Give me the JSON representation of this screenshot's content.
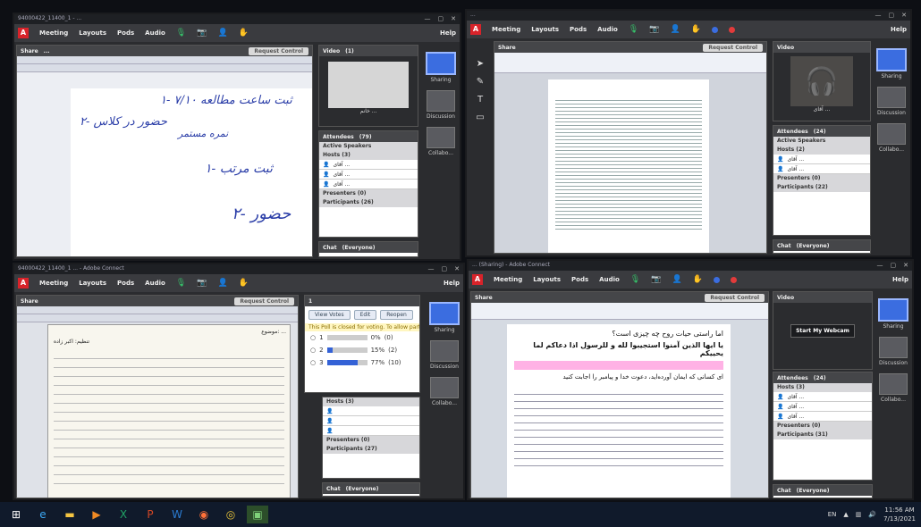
{
  "menu": {
    "meeting": "Meeting",
    "layouts": "Layouts",
    "pods": "Pods",
    "audio": "Audio",
    "help": "Help",
    "adobe": "Adobe"
  },
  "pods": {
    "share": "Share",
    "request_control": "Request Control",
    "video": "Video",
    "attendees": "Attendees",
    "active_speakers": "Active Speakers",
    "presenters": "Presenters (0)",
    "chat": "Chat",
    "chat_scope": "(Everyone)",
    "start_webcam": "Start My Webcam"
  },
  "side": {
    "sharing": "Sharing",
    "discussion": "Discussion",
    "collabo": "Collabo..."
  },
  "w1": {
    "title": "94000422_11400_1 - ...",
    "video_count": "(1)",
    "attendee_count": "(79)",
    "hosts": "Hosts (3)",
    "participants": "Participants (26)",
    "host_names": [
      "آقای ...",
      "آقای ...",
      "آقای ..."
    ],
    "video_name": "خانم ...",
    "share_title": "...",
    "hand1": "۱- ثبت ساعت مطالعه ۷/۱۰",
    "hand2": "۲- حضور در کلاس",
    "hand3": "نمره مستمر",
    "hand4": "۱- ثبت مرتب",
    "hand5": "۲- حضور"
  },
  "w2": {
    "title": "...",
    "attendee_count": "(24)",
    "hosts": "Hosts (2)",
    "participants": "Participants (22)",
    "presenters": "Presenters (0)",
    "host_names": [
      "آقای ...",
      "آقای ..."
    ],
    "video_name": "آقای ..."
  },
  "w3": {
    "title": "94000422_11400_1 ... - Adobe Connect",
    "view_votes": "View Votes",
    "edit": "Edit",
    "reopen": "Reopen",
    "poll_note": "This Poll is closed for voting. To allow part",
    "poll_rows": [
      {
        "n": "1",
        "pct": "0%",
        "count": "(0)",
        "fill": 0.0
      },
      {
        "n": "2",
        "pct": "15%",
        "count": "(2)",
        "fill": 0.15
      },
      {
        "n": "3",
        "pct": "77%",
        "count": "(10)",
        "fill": 0.77
      }
    ],
    "hosts": "Hosts (3)",
    "participants": "Participants (27)",
    "presenters": "Presenters (0)",
    "doc_title": "موضوع: ...",
    "doc_sub": "تنظیم: اکبر زاده"
  },
  "w4": {
    "title": "... (Sharing) - Adobe Connect",
    "attendee_count": "(24)",
    "hosts": "Hosts (3)",
    "participants": "Participants (31)",
    "presenters": "Presenters (0)",
    "host_names": [
      "آقای ...",
      "آقای ...",
      "آقای ..."
    ],
    "text1": "اما راستی حیات روح چه چیزی است؟",
    "text2": "یا ایها الذین آمنوا استجیبوا لله و للرسول اذا دعاکم لما یحییکم",
    "text3": "ای کسانی که ایمان آورده‌اید، دعوت خدا و پیامبر را اجابت کنید"
  },
  "taskbar": {
    "lang": "EN",
    "time": "11:56 AM",
    "date": "7/13/2021"
  }
}
